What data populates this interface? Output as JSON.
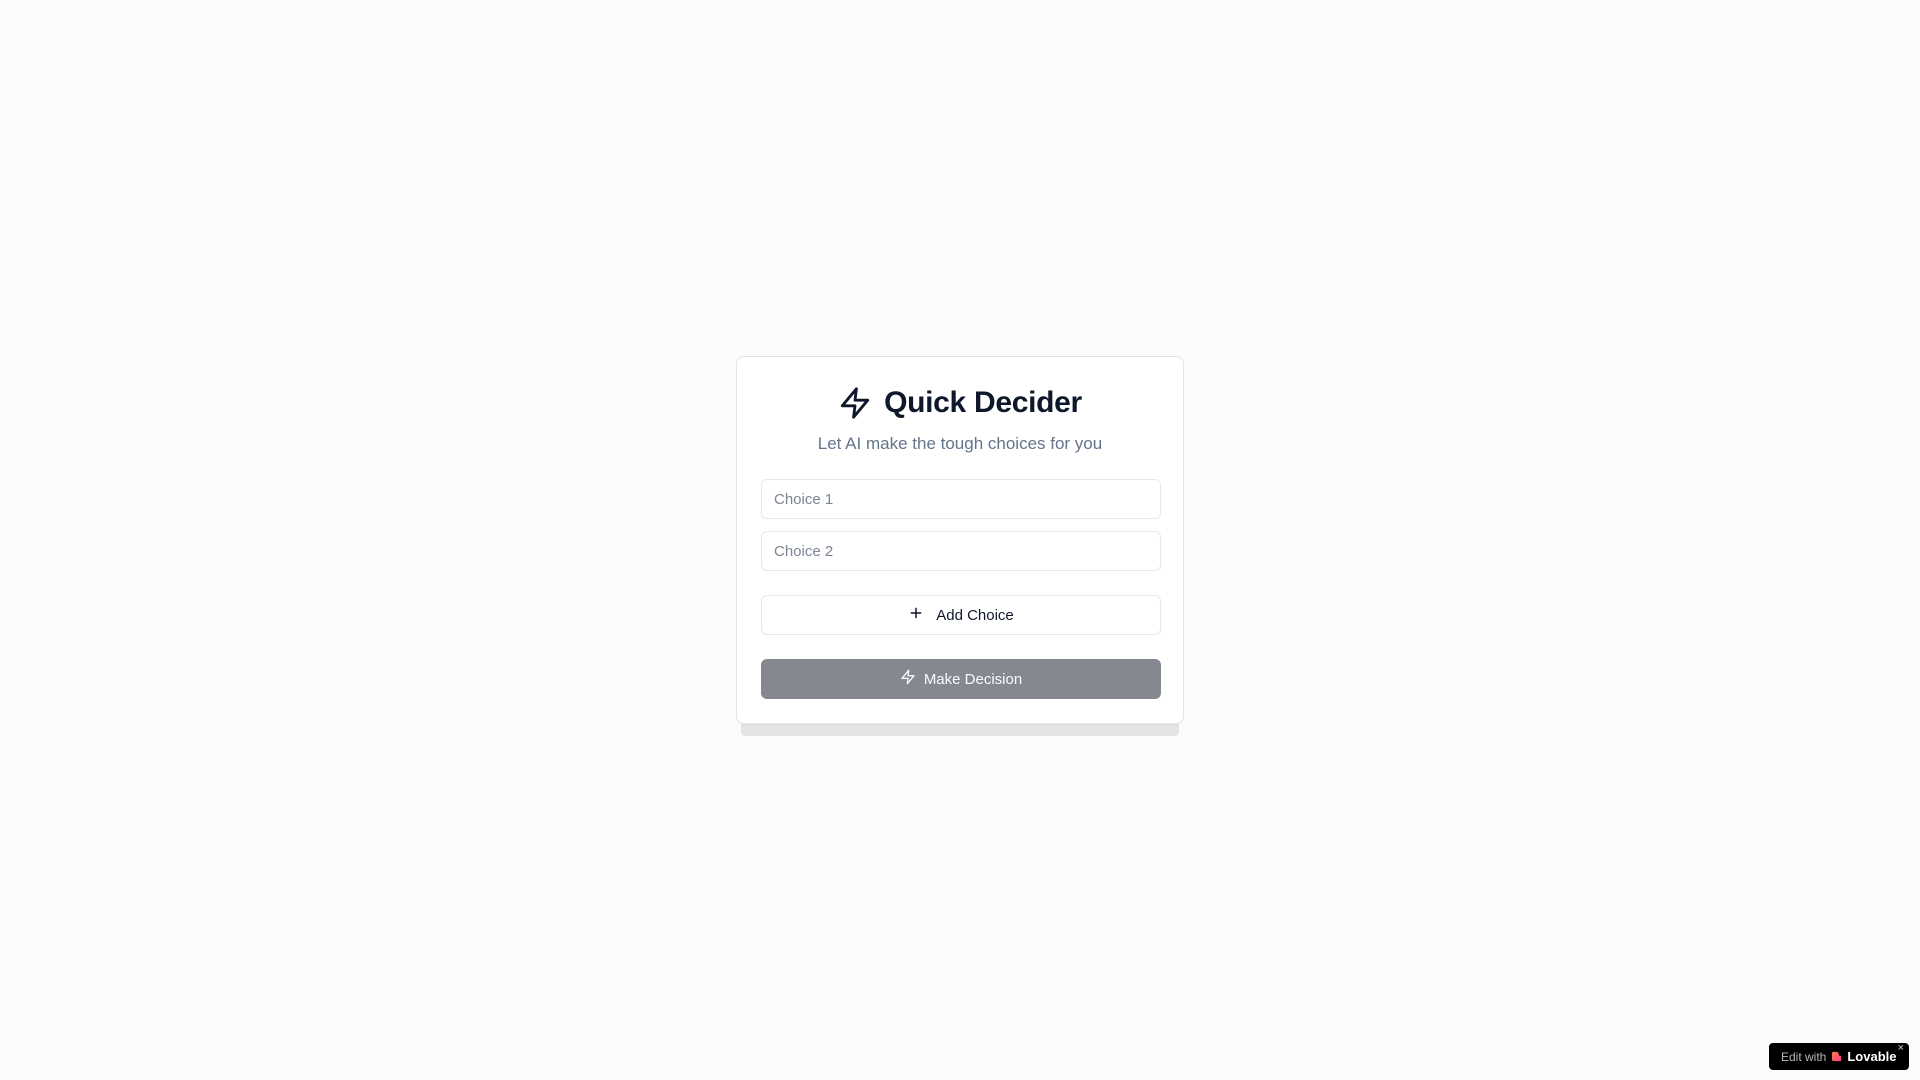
{
  "app": {
    "title": "Quick Decider",
    "subtitle": "Let AI make the tough choices for you",
    "title_icon": "zap-icon"
  },
  "choices": [
    {
      "value": "",
      "placeholder": "Choice 1"
    },
    {
      "value": "",
      "placeholder": "Choice 2"
    }
  ],
  "actions": {
    "add_choice_label": "Add Choice",
    "add_choice_icon": "plus-icon",
    "make_decision_label": "Make Decision",
    "make_decision_icon": "zap-icon",
    "make_decision_disabled": true
  },
  "badge": {
    "edit_text": "Edit with",
    "brand": "Lovable",
    "close": "×"
  },
  "colors": {
    "background": "#fcfcfc",
    "primary_disabled": "#858891",
    "text": "#0f172a",
    "muted": "#64748b"
  }
}
